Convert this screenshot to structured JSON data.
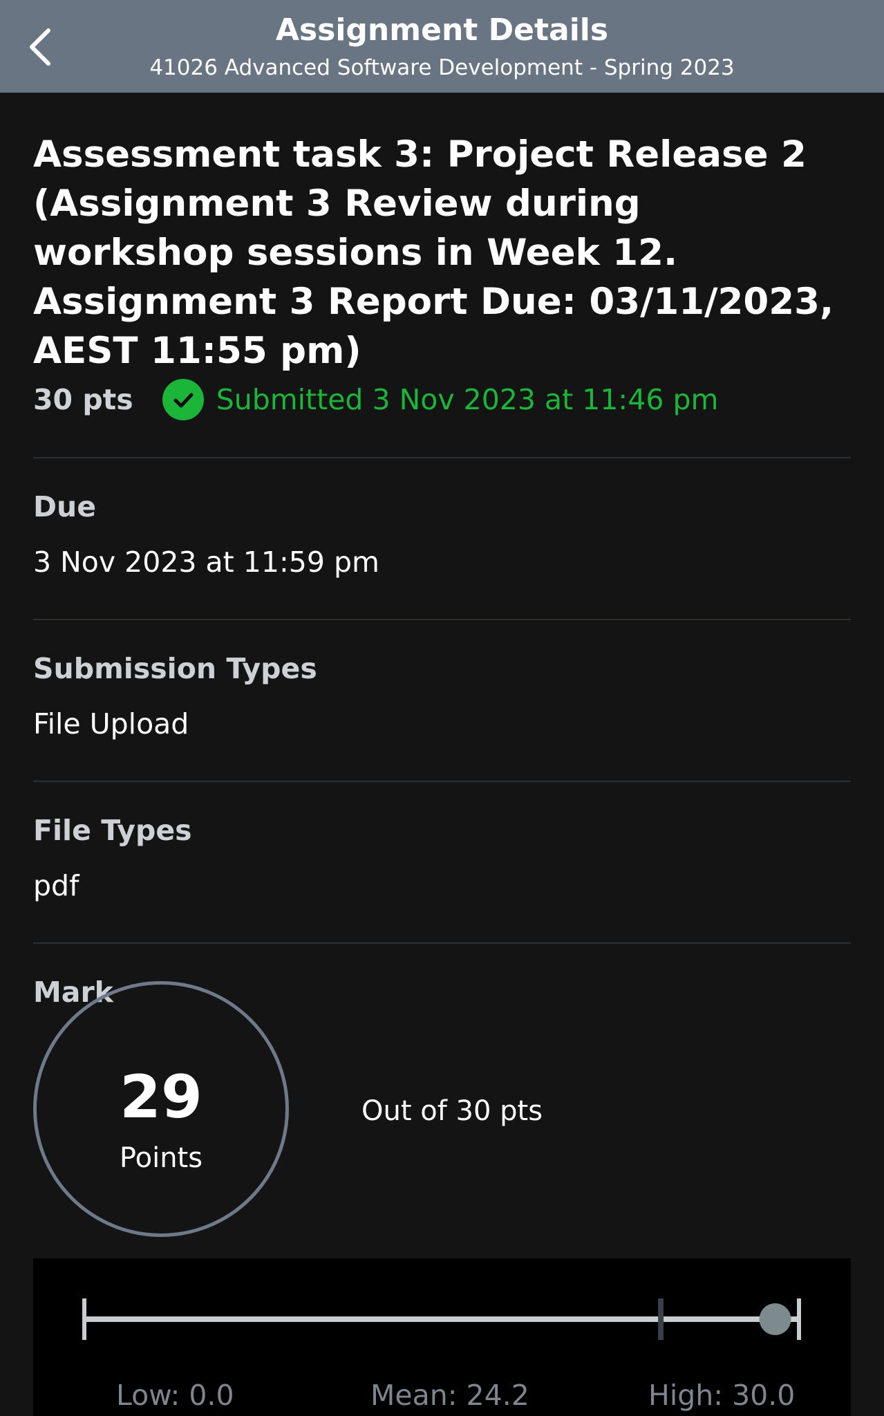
{
  "header": {
    "title": "Assignment Details",
    "subtitle": "41026 Advanced Software Development - Spring 2023",
    "back_icon": "chevron-left-icon"
  },
  "assignment": {
    "title": "Assessment task 3: Project Release 2 (Assignment 3 Review during workshop sessions in Week 12. Assignment 3 Report Due: 03/11/2023, AEST 11:55 pm)",
    "points": "30 pts",
    "status_icon": "check-circle-icon",
    "status": "Submitted 3 Nov 2023 at 11:46 pm"
  },
  "sections": {
    "due": {
      "label": "Due",
      "value": "3 Nov 2023 at 11:59 pm"
    },
    "submission_types": {
      "label": "Submission Types",
      "value": "File Upload"
    },
    "file_types": {
      "label": "File Types",
      "value": "pdf"
    }
  },
  "mark": {
    "label": "Mark",
    "score": "29",
    "unit": "Points",
    "out_of": "Out of 30 pts"
  },
  "stats": {
    "low_label": "Low: 0.0",
    "mean_label": "Mean: 24.2",
    "high_label": "High: 30.0",
    "low": 0.0,
    "mean": 24.2,
    "high": 30.0,
    "score": 29
  },
  "colors": {
    "header_bg": "#6a7584",
    "page_bg": "#141414",
    "success": "#1bb53a",
    "ring": "#6e7a8a",
    "divider": "#2b2f36"
  }
}
